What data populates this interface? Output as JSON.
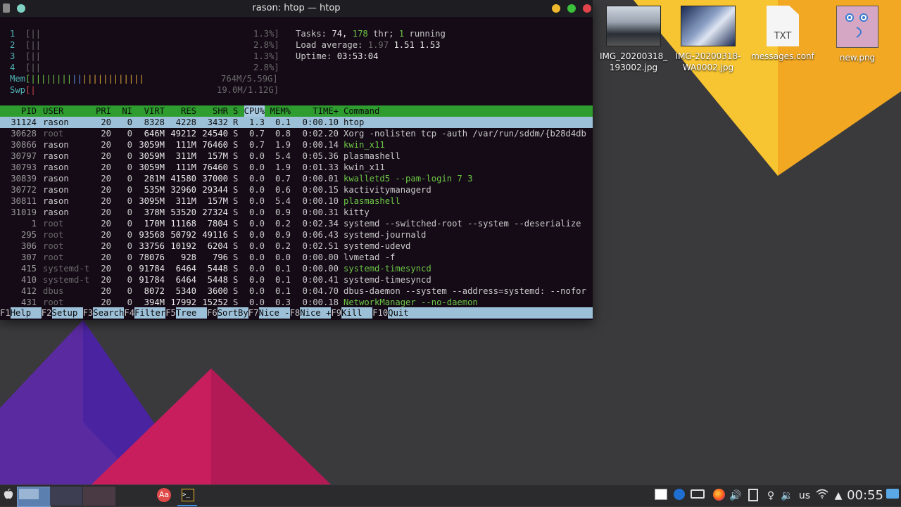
{
  "window": {
    "title": "rason: htop — htop"
  },
  "meters": {
    "cpus": [
      {
        "label": "1",
        "bar": "[||",
        "pct": "1.3%]"
      },
      {
        "label": "2",
        "bar": "[||",
        "pct": "2.8%]"
      },
      {
        "label": "3",
        "bar": "[||",
        "pct": "1.3%]"
      },
      {
        "label": "4",
        "bar": "[||",
        "pct": "2.8%]"
      }
    ],
    "mem": {
      "label": "Mem",
      "bar_green": "[||||||||",
      "bar_blue": "||",
      "bar_yellow": "||||||||||||",
      "value": "764M/5.59G]"
    },
    "swp": {
      "label": "Swp",
      "bar": "[|",
      "value": "19.0M/1.12G]"
    }
  },
  "summary": {
    "tasks_label": "Tasks:",
    "tasks": "74,",
    "threads": "178",
    "thr_label": "thr;",
    "running": "1",
    "running_label": "running",
    "load_label": "Load average:",
    "load1": "1.97",
    "load5": "1.51",
    "load15": "1.53",
    "uptime_label": "Uptime:",
    "uptime": "03:53:04"
  },
  "columns": [
    "PID",
    "USER",
    "PRI",
    "NI",
    "VIRT",
    "RES",
    "SHR",
    "S",
    "CPU%",
    "MEM%",
    "TIME+",
    "Command"
  ],
  "processes": [
    {
      "pid": "31124",
      "user": "rason",
      "pri": "20",
      "ni": "0",
      "virt": "8328",
      "res": "4228",
      "shr": "3432",
      "s": "R",
      "cpu": "1.3",
      "mem": "0.1",
      "time": "0:00.10",
      "cmd": "htop",
      "sel": true
    },
    {
      "pid": "30628",
      "user": "root",
      "pri": "20",
      "ni": "0",
      "virt": "646M",
      "res": "49212",
      "shr": "24540",
      "s": "S",
      "cpu": "0.7",
      "mem": "0.8",
      "time": "0:02.20",
      "cmd": "Xorg -nolisten tcp -auth /var/run/sddm/{b28d4db"
    },
    {
      "pid": "30866",
      "user": "rason",
      "pri": "20",
      "ni": "0",
      "virt": "3059M",
      "res": "111M",
      "shr": "76460",
      "s": "S",
      "cpu": "0.7",
      "mem": "1.9",
      "time": "0:00.14",
      "cmd": "kwin_x11",
      "green": true
    },
    {
      "pid": "30797",
      "user": "rason",
      "pri": "20",
      "ni": "0",
      "virt": "3059M",
      "res": "311M",
      "shr": "157M",
      "s": "S",
      "cpu": "0.0",
      "mem": "5.4",
      "time": "0:05.36",
      "cmd": "plasmashell"
    },
    {
      "pid": "30793",
      "user": "rason",
      "pri": "20",
      "ni": "0",
      "virt": "3059M",
      "res": "111M",
      "shr": "76460",
      "s": "S",
      "cpu": "0.0",
      "mem": "1.9",
      "time": "0:01.33",
      "cmd": "kwin_x11"
    },
    {
      "pid": "30839",
      "user": "rason",
      "pri": "20",
      "ni": "0",
      "virt": "281M",
      "res": "41580",
      "shr": "37000",
      "s": "S",
      "cpu": "0.0",
      "mem": "0.7",
      "time": "0:00.01",
      "cmd": "kwalletd5 --pam-login 7 3",
      "green": true
    },
    {
      "pid": "30772",
      "user": "rason",
      "pri": "20",
      "ni": "0",
      "virt": "535M",
      "res": "32960",
      "shr": "29344",
      "s": "S",
      "cpu": "0.0",
      "mem": "0.6",
      "time": "0:00.15",
      "cmd": "kactivitymanagerd"
    },
    {
      "pid": "30811",
      "user": "rason",
      "pri": "20",
      "ni": "0",
      "virt": "3095M",
      "res": "311M",
      "shr": "157M",
      "s": "S",
      "cpu": "0.0",
      "mem": "5.4",
      "time": "0:00.10",
      "cmd": "plasmashell",
      "green": true
    },
    {
      "pid": "31019",
      "user": "rason",
      "pri": "20",
      "ni": "0",
      "virt": "378M",
      "res": "53520",
      "shr": "27324",
      "s": "S",
      "cpu": "0.0",
      "mem": "0.9",
      "time": "0:00.31",
      "cmd": "kitty"
    },
    {
      "pid": "1",
      "user": "root",
      "pri": "20",
      "ni": "0",
      "virt": "170M",
      "res": "11168",
      "shr": "7804",
      "s": "S",
      "cpu": "0.0",
      "mem": "0.2",
      "time": "0:02.34",
      "cmd": "systemd --switched-root --system --deserialize"
    },
    {
      "pid": "295",
      "user": "root",
      "pri": "20",
      "ni": "0",
      "virt": "93568",
      "res": "50792",
      "shr": "49116",
      "s": "S",
      "cpu": "0.0",
      "mem": "0.9",
      "time": "0:06.43",
      "cmd": "systemd-journald"
    },
    {
      "pid": "306",
      "user": "root",
      "pri": "20",
      "ni": "0",
      "virt": "33756",
      "res": "10192",
      "shr": "6204",
      "s": "S",
      "cpu": "0.0",
      "mem": "0.2",
      "time": "0:02.51",
      "cmd": "systemd-udevd"
    },
    {
      "pid": "307",
      "user": "root",
      "pri": "20",
      "ni": "0",
      "virt": "78076",
      "res": "928",
      "shr": "796",
      "s": "S",
      "cpu": "0.0",
      "mem": "0.0",
      "time": "0:00.00",
      "cmd": "lvmetad -f"
    },
    {
      "pid": "415",
      "user": "systemd-t",
      "pri": "20",
      "ni": "0",
      "virt": "91784",
      "res": "6464",
      "shr": "5448",
      "s": "S",
      "cpu": "0.0",
      "mem": "0.1",
      "time": "0:00.00",
      "cmd": "systemd-timesyncd",
      "green": true
    },
    {
      "pid": "410",
      "user": "systemd-t",
      "pri": "20",
      "ni": "0",
      "virt": "91784",
      "res": "6464",
      "shr": "5448",
      "s": "S",
      "cpu": "0.0",
      "mem": "0.1",
      "time": "0:00.41",
      "cmd": "systemd-timesyncd"
    },
    {
      "pid": "412",
      "user": "dbus",
      "pri": "20",
      "ni": "0",
      "virt": "8072",
      "res": "5340",
      "shr": "3600",
      "s": "S",
      "cpu": "0.0",
      "mem": "0.1",
      "time": "0:04.70",
      "cmd": "dbus-daemon --system --address=systemd: --nofor"
    },
    {
      "pid": "431",
      "user": "root",
      "pri": "20",
      "ni": "0",
      "virt": "394M",
      "res": "17992",
      "shr": "15252",
      "s": "S",
      "cpu": "0.0",
      "mem": "0.3",
      "time": "0:00.18",
      "cmd": "NetworkManager --no-daemon",
      "green": true
    }
  ],
  "fkeys": [
    {
      "key": "F1",
      "label": "Help  "
    },
    {
      "key": "F2",
      "label": "Setup "
    },
    {
      "key": "F3",
      "label": "Search"
    },
    {
      "key": "F4",
      "label": "Filter"
    },
    {
      "key": "F5",
      "label": "Tree  "
    },
    {
      "key": "F6",
      "label": "SortBy"
    },
    {
      "key": "F7",
      "label": "Nice -"
    },
    {
      "key": "F8",
      "label": "Nice +"
    },
    {
      "key": "F9",
      "label": "Kill  "
    },
    {
      "key": "F10",
      "label": "Quit"
    }
  ],
  "desktop_icons": [
    {
      "name": "IMG_20200318_193002.jpg",
      "line1": "IMG_20200318_",
      "line2": "193002.jpg",
      "kind": "photo"
    },
    {
      "name": "IMG-20200318-WA0002.jpg",
      "line1": "IMG-20200318-",
      "line2": "WA0002.jpg",
      "kind": "photo"
    },
    {
      "name": "messages.conf",
      "line1": "messages.conf",
      "line2": "",
      "kind": "txt",
      "badge": "TXT"
    },
    {
      "name": "new.png",
      "line1": "new.png",
      "line2": "",
      "kind": "png"
    }
  ],
  "taskbar": {
    "clock": "00:55",
    "keyboard_layout": "us",
    "font_app_label": "Aa"
  },
  "colors": {
    "title_close": "#e0444a",
    "title_max": "#3cc13b",
    "title_min": "#f0b82c",
    "htop_header_bg": "#2e9c2e",
    "htop_selection_bg": "#9cc0d8"
  }
}
